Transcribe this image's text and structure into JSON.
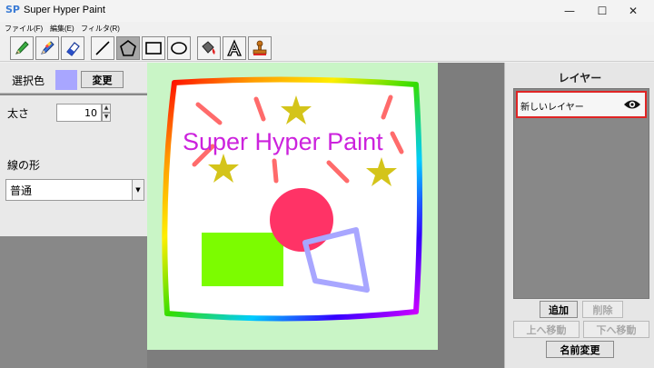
{
  "window": {
    "title": "Super Hyper Paint",
    "icon_text": "SP"
  },
  "window_controls": {
    "minimize": "—",
    "maximize": "☐",
    "close": "✕"
  },
  "menu": [
    {
      "label": "ファイル(F)"
    },
    {
      "label": "編集(E)"
    },
    {
      "label": "フィルタ(R)"
    }
  ],
  "toolbar": {
    "tools": [
      "pencil",
      "color-pencil",
      "eraser",
      "line",
      "polygon",
      "rectangle",
      "ellipse",
      "fill-bucket",
      "text",
      "stamp"
    ],
    "active_tool": "polygon"
  },
  "left_panel": {
    "color_label": "選択色",
    "selected_color": "#a8a6ff",
    "change_button": "変更",
    "thickness_label": "太さ",
    "thickness_value": "10",
    "line_shape_label": "線の形",
    "line_shape_value": "普通"
  },
  "canvas": {
    "background": "#c9f5c6",
    "paper": "#ffffff",
    "text": "Super Hyper Paint",
    "text_color": "#cc22dd",
    "shapes": [
      {
        "type": "rectangle",
        "color": "#7cfc00"
      },
      {
        "type": "circle",
        "color": "#ff3366"
      },
      {
        "type": "polygon-outline",
        "color": "#a8a6ff"
      },
      {
        "type": "star",
        "color": "#d4c41a"
      },
      {
        "type": "rays",
        "color": "#ff6b6b"
      }
    ]
  },
  "right_panel": {
    "title": "レイヤー",
    "layers": [
      {
        "name": "新しいレイヤー",
        "visible": true
      }
    ],
    "buttons": {
      "add": "追加",
      "delete": "削除",
      "move_up": "上へ移動",
      "move_down": "下へ移動",
      "rename": "名前変更"
    }
  }
}
